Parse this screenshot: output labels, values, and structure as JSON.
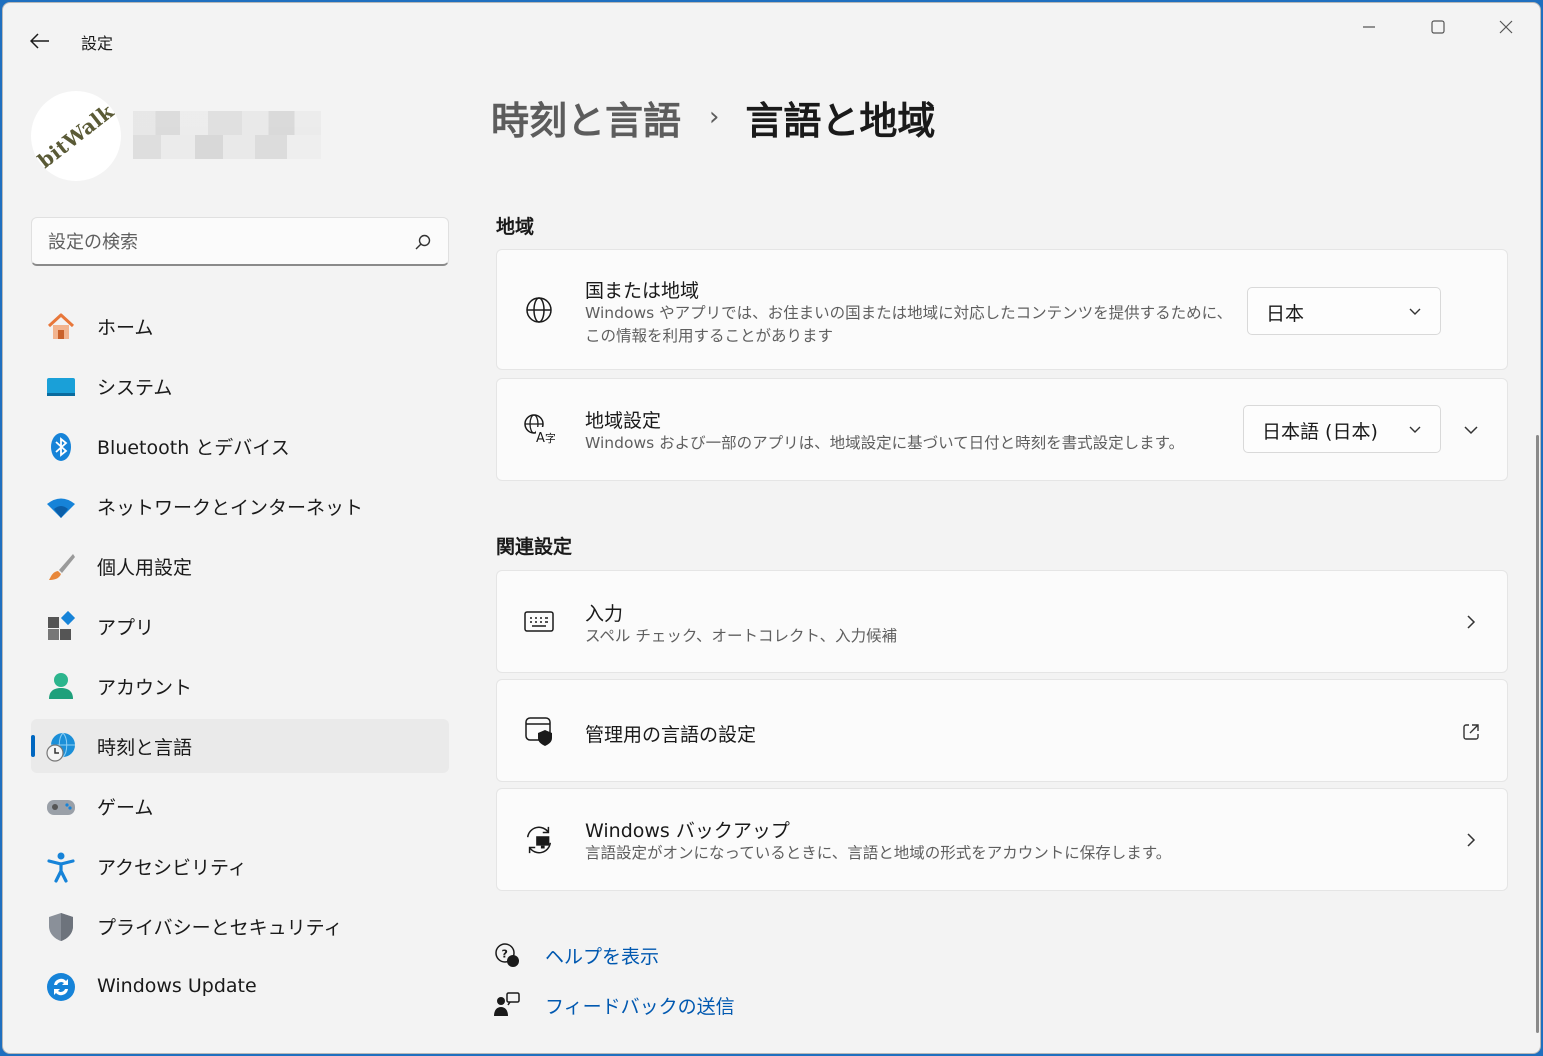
{
  "window": {
    "title": "設定"
  },
  "profile": {
    "avatar_text": "bitWalk"
  },
  "search": {
    "placeholder": "設定の検索"
  },
  "sidebar": {
    "items": [
      {
        "label": "ホーム",
        "icon": "home-icon"
      },
      {
        "label": "システム",
        "icon": "system-icon"
      },
      {
        "label": "Bluetooth とデバイス",
        "icon": "bluetooth-icon"
      },
      {
        "label": "ネットワークとインターネット",
        "icon": "wifi-icon"
      },
      {
        "label": "個人用設定",
        "icon": "brush-icon"
      },
      {
        "label": "アプリ",
        "icon": "apps-icon"
      },
      {
        "label": "アカウント",
        "icon": "account-icon"
      },
      {
        "label": "時刻と言語",
        "icon": "time-language-icon"
      },
      {
        "label": "ゲーム",
        "icon": "gamepad-icon"
      },
      {
        "label": "アクセシビリティ",
        "icon": "accessibility-icon"
      },
      {
        "label": "プライバシーとセキュリティ",
        "icon": "shield-icon"
      },
      {
        "label": "Windows Update",
        "icon": "update-icon"
      }
    ]
  },
  "breadcrumb": {
    "parent": "時刻と言語",
    "separator": "›",
    "current": "言語と地域"
  },
  "region_section": {
    "title": "地域",
    "country": {
      "title": "国または地域",
      "desc_line1": "Windows やアプリでは、お住まいの国または地域に対応したコンテンツを提供するために、",
      "desc_line2": "この情報を利用することがあります",
      "value": "日本"
    },
    "format": {
      "title": "地域設定",
      "desc": "Windows および一部のアプリは、地域設定に基づいて日付と時刻を書式設定します。",
      "value": "日本語 (日本)"
    }
  },
  "related_section": {
    "title": "関連設定",
    "input": {
      "title": "入力",
      "desc": "スペル チェック、オートコレクト、入力候補"
    },
    "admin_language": {
      "title": "管理用の言語の設定"
    },
    "backup": {
      "title": "Windows バックアップ",
      "desc": "言語設定がオンになっているときに、言語と地域の形式をアカウントに保存します。"
    }
  },
  "footer": {
    "help": "ヘルプを表示",
    "feedback": "フィードバックの送信"
  },
  "colors": {
    "accent": "#0067c0",
    "link": "#0058b0",
    "background": "#f3f3f3",
    "card": "#fbfbfb"
  }
}
